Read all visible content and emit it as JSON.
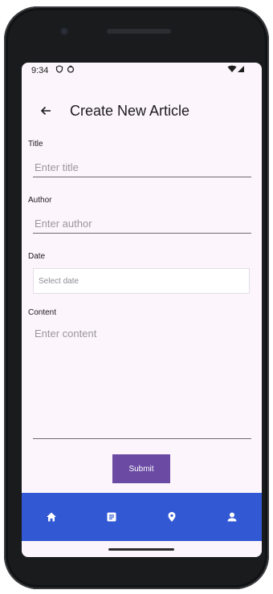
{
  "status_bar": {
    "time": "9:34"
  },
  "header": {
    "title": "Create New Article",
    "back_icon": "arrow-back-icon"
  },
  "form": {
    "title_label": "Title",
    "title_placeholder": "Enter title",
    "author_label": "Author",
    "author_placeholder": "Enter author",
    "date_label": "Date",
    "date_placeholder": "Select date",
    "content_label": "Content",
    "content_placeholder": "Enter content",
    "submit_label": "Submit"
  },
  "bottom_nav": {
    "items": [
      {
        "icon": "home-icon"
      },
      {
        "icon": "article-icon"
      },
      {
        "icon": "location-pin-icon"
      },
      {
        "icon": "person-icon"
      }
    ]
  },
  "colors": {
    "screen_background": "#fcf5fb",
    "accent": "#6a4aa3",
    "nav_background": "#3358d4"
  }
}
